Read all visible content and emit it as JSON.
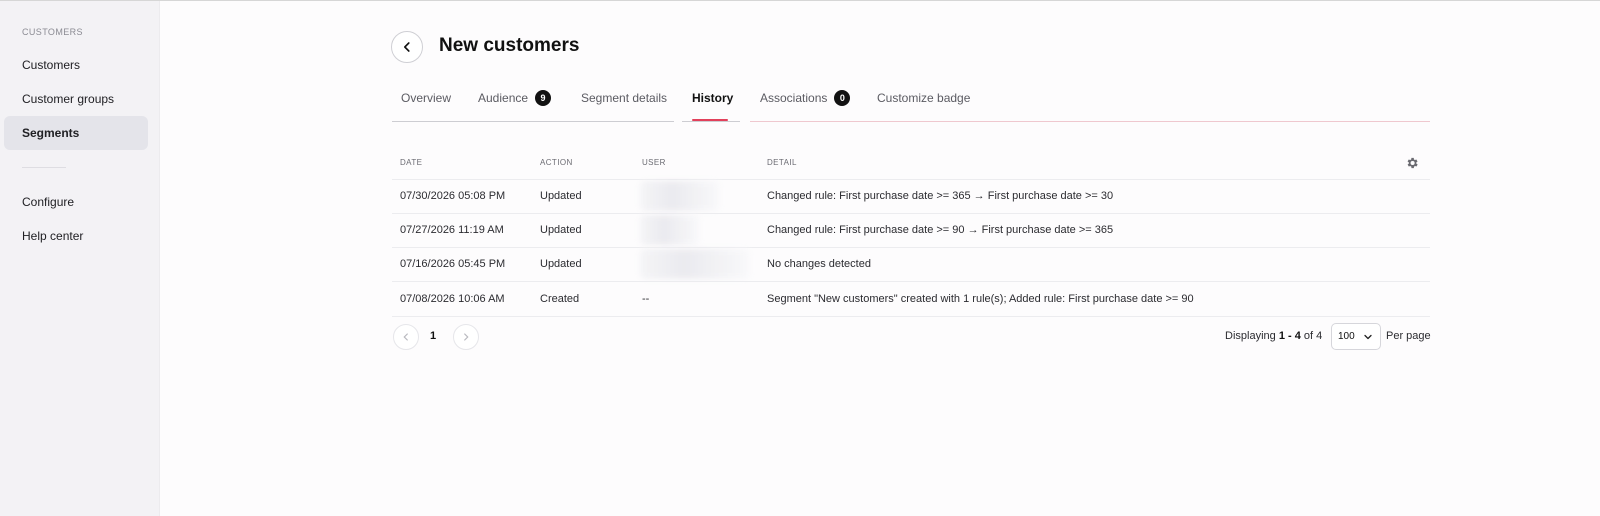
{
  "sidebar": {
    "heading": "CUSTOMERS",
    "items": [
      {
        "label": "Customers"
      },
      {
        "label": "Customer groups"
      },
      {
        "label": "Segments"
      },
      {
        "label": "Configure"
      },
      {
        "label": "Help center"
      }
    ],
    "active": "Segments"
  },
  "header": {
    "title": "New customers",
    "back_icon": "chevron-left-icon"
  },
  "tabs": [
    {
      "label": "Overview"
    },
    {
      "label": "Audience",
      "badge": "9"
    },
    {
      "label": "Segment details"
    },
    {
      "label": "History"
    },
    {
      "label": "Associations",
      "badge": "0"
    },
    {
      "label": "Customize badge"
    }
  ],
  "active_tab": "History",
  "table": {
    "columns": [
      "DATE",
      "ACTION",
      "USER",
      "DETAIL"
    ],
    "settings_icon": "gear-icon",
    "rows": [
      {
        "date": "07/30/2026 05:08 PM",
        "action": "Updated",
        "user": "",
        "detail": "Changed rule: First purchase date >= 365 → First purchase date >= 30"
      },
      {
        "date": "07/27/2026 11:19 AM",
        "action": "Updated",
        "user": "",
        "detail": "Changed rule: First purchase date >= 90 → First purchase date >= 365"
      },
      {
        "date": "07/16/2026 05:45 PM",
        "action": "Updated",
        "user": "",
        "detail": "No changes detected"
      },
      {
        "date": "07/08/2026 10:06 AM",
        "action": "Created",
        "user": "--",
        "detail": "Segment \"New customers\" created with 1 rule(s); Added rule: First purchase date >= 90"
      }
    ]
  },
  "pagination": {
    "current_page": "1",
    "displaying_prefix": "Displaying",
    "range": "1 - 4",
    "of_label": "of",
    "total": "4",
    "per_page_value": "100",
    "per_page_label": "Per page"
  },
  "colors": {
    "accent": "#e2405b",
    "badge_bg": "#121212",
    "sidebar_bg": "#f3f2f5"
  }
}
